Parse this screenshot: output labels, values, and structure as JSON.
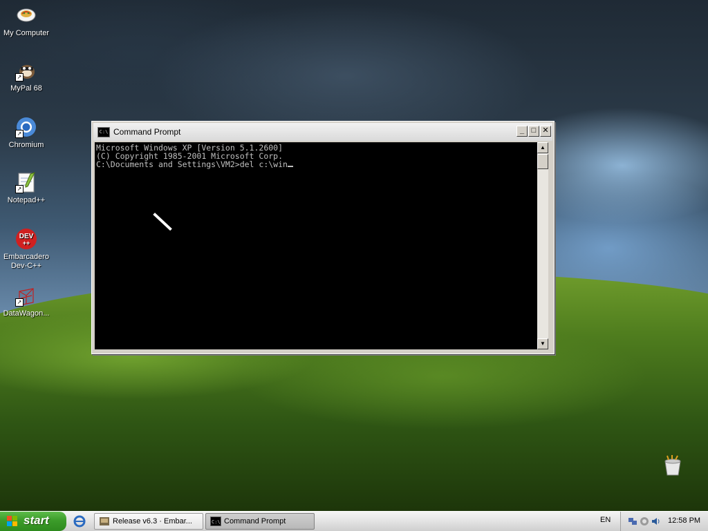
{
  "desktop": {
    "icons": [
      {
        "label": "My Computer",
        "icon": "my-computer-icon",
        "shortcut": false
      },
      {
        "label": "MyPal 68",
        "icon": "mypal-icon",
        "shortcut": true
      },
      {
        "label": "Chromium",
        "icon": "chromium-icon",
        "shortcut": true
      },
      {
        "label": "Notepad++",
        "icon": "notepadpp-icon",
        "shortcut": true
      },
      {
        "label": "Embarcadero Dev-C++",
        "icon": "devcpp-icon",
        "shortcut": false,
        "badge": "DEV"
      },
      {
        "label": "DataWagon...",
        "icon": "datawagon-icon",
        "shortcut": true
      }
    ]
  },
  "window": {
    "title": "Command Prompt",
    "icon_text": "C:\\",
    "buttons": {
      "minimize": "_",
      "maximize": "□",
      "close": "✕"
    },
    "console_lines": [
      "Microsoft Windows XP [Version 5.1.2600]",
      "(C) Copyright 1985-2001 Microsoft Corp.",
      "",
      "C:\\Documents and Settings\\VM2>del c:\\win"
    ]
  },
  "taskbar": {
    "start_label": "start",
    "tasks": [
      {
        "label": "Release v6.3 · Embar...",
        "active": false
      },
      {
        "label": "Command Prompt",
        "active": true
      }
    ],
    "language": "EN",
    "clock": "12:58 PM"
  },
  "colors": {
    "console_bg": "#000000",
    "console_fg": "#c0c0c0",
    "start_green": "#3c9c2a"
  }
}
